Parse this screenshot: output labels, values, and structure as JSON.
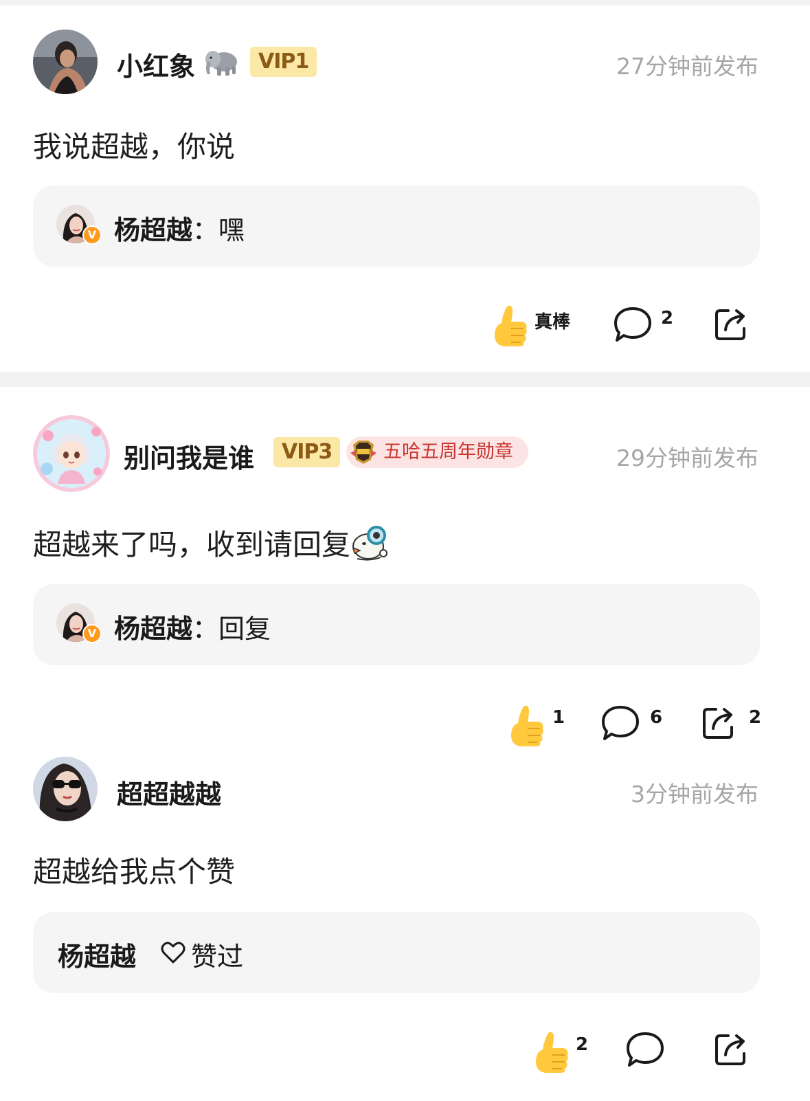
{
  "posts": [
    {
      "username": "小红象",
      "emoji_badge": "elephant-emoji",
      "vip": "VIP1",
      "timestamp": "27分钟前发布",
      "text": "我说超越，你说",
      "reply": {
        "name": "杨超越",
        "text": "嘿"
      },
      "actions": {
        "like": "真棒",
        "comment": "2",
        "share": ""
      }
    },
    {
      "username": "别问我是谁",
      "vip": "VIP3",
      "medal": "五哈五周年勋章",
      "timestamp": "29分钟前发布",
      "text": "超越来了吗，收到请回复",
      "inline_emoji": "bird-magnifier-emoji",
      "reply": {
        "name": "杨超越",
        "text": "回复"
      },
      "actions": {
        "like": "1",
        "comment": "6",
        "share": "2"
      }
    },
    {
      "username": "超超越越",
      "timestamp": "3分钟前发布",
      "text": "超越给我点个赞",
      "liked_by": {
        "name": "杨超越",
        "label": "赞过"
      },
      "actions": {
        "like": "2",
        "comment": "",
        "share": ""
      }
    }
  ],
  "reply_separator": "：",
  "verified_mark": "V",
  "colors": {
    "vip_bg": "#fbe7a6",
    "vip_text": "#8b5a14",
    "medal_bg": "#fde4e4",
    "medal_text": "#c7352f",
    "timestamp": "#a6a6a6",
    "verified": "#ff9a1f",
    "thumb": "#ffc83d"
  }
}
